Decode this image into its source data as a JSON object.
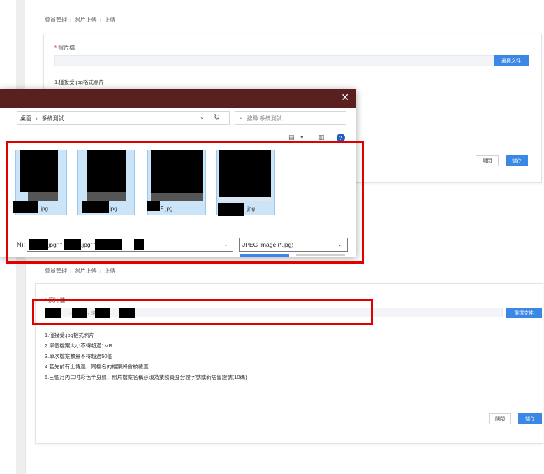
{
  "breadcrumb": {
    "level1": "會員管理",
    "level2": "照片上傳",
    "level3": "上傳",
    "separator": "›"
  },
  "form": {
    "field_label": "照片檔",
    "required_mark": "*",
    "choose_button": "選擇文件",
    "selected_files_text": ".jpg, .jpg, .jpg, .jpg",
    "rules": [
      "1.僅接受.jpg格式照片",
      "2.單個檔案大小不得超過1MB",
      "3.單次檔案數量不得超過50個",
      "4.若先前有上傳過，同檔名的檔案將會被覆蓋",
      "5.三個月內二吋彩色半身照，照片檔案名稱必須為業務員身分證字號或新居留證號(10碼)"
    ],
    "close_button": "關閉",
    "save_button": "儲存"
  },
  "dialog": {
    "close_glyph": "✕",
    "path_root": "桌面",
    "path_sep": "›",
    "path_folder": "系統測試",
    "dropdown_glyph": "⌄",
    "refresh_glyph": "↻",
    "search_icon_glyph": "⌕",
    "search_placeholder": "搜尋 系統測試",
    "view_glyph": "▤",
    "view_arrow_glyph": "▾",
    "pane_glyph": "▥",
    "help_glyph": "?",
    "thumbnails": [
      {
        "label": ".jpg"
      },
      {
        "label": "jpg"
      },
      {
        "label": "9.jpg"
      },
      {
        "label": ".jpg"
      }
    ],
    "filename_label": "N):",
    "filename_value": ".jpg\"  \"  .jpg\"  \"  .jpg\"  \"  .jpg\"",
    "filetype_value": "JPEG Image (*.jpg)",
    "filetype_arrow": "⌄"
  }
}
